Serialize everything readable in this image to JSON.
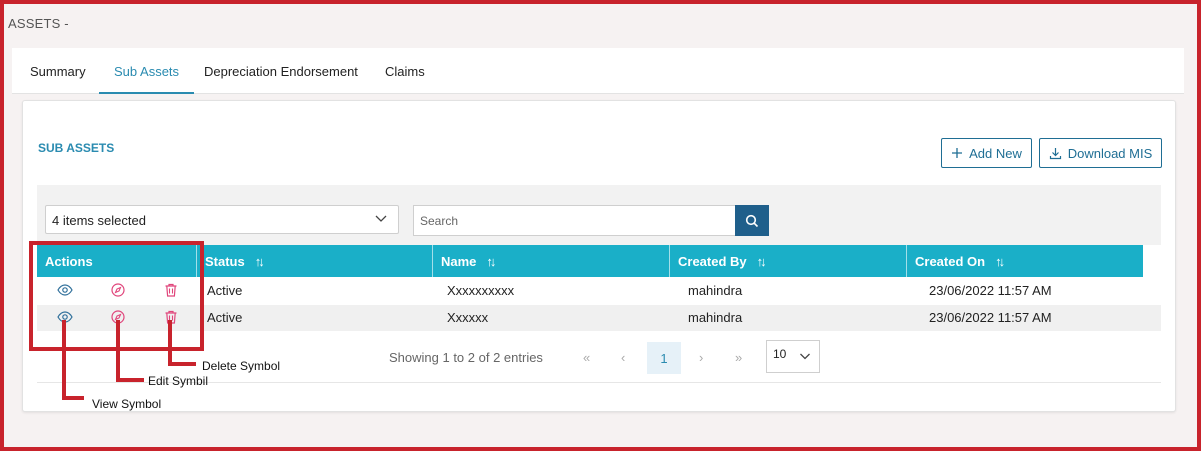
{
  "page": {
    "title": "ASSETS -"
  },
  "tabs": [
    {
      "label": "Summary",
      "active": false
    },
    {
      "label": "Sub Assets",
      "active": true
    },
    {
      "label": "Depreciation Endorsement",
      "active": false
    },
    {
      "label": "Claims",
      "active": false
    }
  ],
  "section": {
    "title": "SUB ASSETS"
  },
  "buttons": {
    "add_new": "Add New",
    "download_mis": "Download MIS"
  },
  "filters": {
    "selection": "4 items selected",
    "search_placeholder": "Search",
    "search_value": ""
  },
  "table": {
    "headers": {
      "actions": "Actions",
      "status": "Status",
      "name": "Name",
      "created_by": "Created By",
      "created_on": "Created On"
    },
    "rows": [
      {
        "status": "Active",
        "name": "Xxxxxxxxxx",
        "created_by": "mahindra",
        "created_on": "23/06/2022 11:57 AM"
      },
      {
        "status": "Active",
        "name": "Xxxxxx",
        "created_by": "mahindra",
        "created_on": "23/06/2022 11:57 AM"
      }
    ]
  },
  "pagination": {
    "info": "Showing 1 to 2 of 2 entries",
    "first": "«",
    "prev": "‹",
    "current_page": "1",
    "next": "›",
    "last": "»",
    "page_size": "10"
  },
  "annotations": {
    "view": "View Symbol",
    "edit": "Edit Symbil",
    "delete": "Delete Symbol"
  },
  "colors": {
    "header_bg": "#1aafc8",
    "accent": "#2a8bb0",
    "button_border": "#1f6e94",
    "search_button": "#1f5f8b",
    "delete_icon": "#e0457b",
    "view_icon": "#2f6f9a",
    "annotation": "#c8232c"
  },
  "icons": {
    "view": "eye-icon",
    "edit": "compass-edit-icon",
    "delete": "trash-icon",
    "add": "plus-icon",
    "download": "download-icon",
    "search": "search-icon",
    "sort": "sort-icon",
    "dropdown": "chevron-down-icon"
  }
}
